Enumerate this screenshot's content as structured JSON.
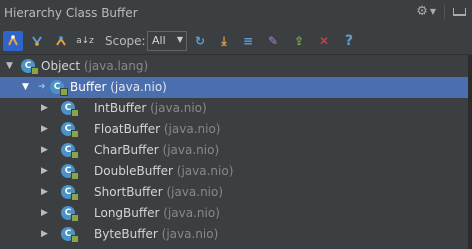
{
  "window": {
    "title": "Hierarchy Class Buffer"
  },
  "title_actions": [
    {
      "icon": "gear-icon"
    },
    {
      "icon": "pin-icon"
    }
  ],
  "toolbar": {
    "buttons": [
      {
        "icon": "class-hierarchy-icon",
        "active": true
      },
      {
        "icon": "supertypes-icon"
      },
      {
        "icon": "subtypes-icon"
      },
      {
        "icon": "sort-alpha-icon",
        "glyph": "a↓z"
      }
    ],
    "scope_label": "Scope:",
    "scope_value": "All",
    "actions": [
      {
        "icon": "refresh-icon",
        "glyph": "↻",
        "color": "#5a9fd6"
      },
      {
        "icon": "expand-all-icon",
        "glyph": "⤓",
        "color": "#e8a33c"
      },
      {
        "icon": "collapse-all-icon",
        "glyph": "≡",
        "color": "#5a9fd6"
      },
      {
        "icon": "pin-tab-icon",
        "glyph": "✎",
        "color": "#b07ed6"
      },
      {
        "icon": "export-icon",
        "glyph": "⇪",
        "color": "#7cb342"
      },
      {
        "icon": "close-icon",
        "glyph": "✕",
        "color": "#e0443e"
      },
      {
        "icon": "help-icon",
        "glyph": "?",
        "color": "#5a9fd6"
      }
    ]
  },
  "tree": {
    "rows": [
      {
        "name": "Object",
        "pkg": " (java.lang)",
        "level": 0,
        "expanded": true
      },
      {
        "name": "Buffer",
        "pkg": " (java.nio)",
        "level": 1,
        "expanded": true,
        "selected": true
      },
      {
        "name": "IntBuffer",
        "pkg": " (java.nio)",
        "level": 2
      },
      {
        "name": "FloatBuffer",
        "pkg": " (java.nio)",
        "level": 2
      },
      {
        "name": "CharBuffer",
        "pkg": " (java.nio)",
        "level": 2
      },
      {
        "name": "DoubleBuffer",
        "pkg": " (java.nio)",
        "level": 2
      },
      {
        "name": "ShortBuffer",
        "pkg": " (java.nio)",
        "level": 2
      },
      {
        "name": "LongBuffer",
        "pkg": " (java.nio)",
        "level": 2
      },
      {
        "name": "ByteBuffer",
        "pkg": " (java.nio)",
        "level": 2
      }
    ]
  }
}
